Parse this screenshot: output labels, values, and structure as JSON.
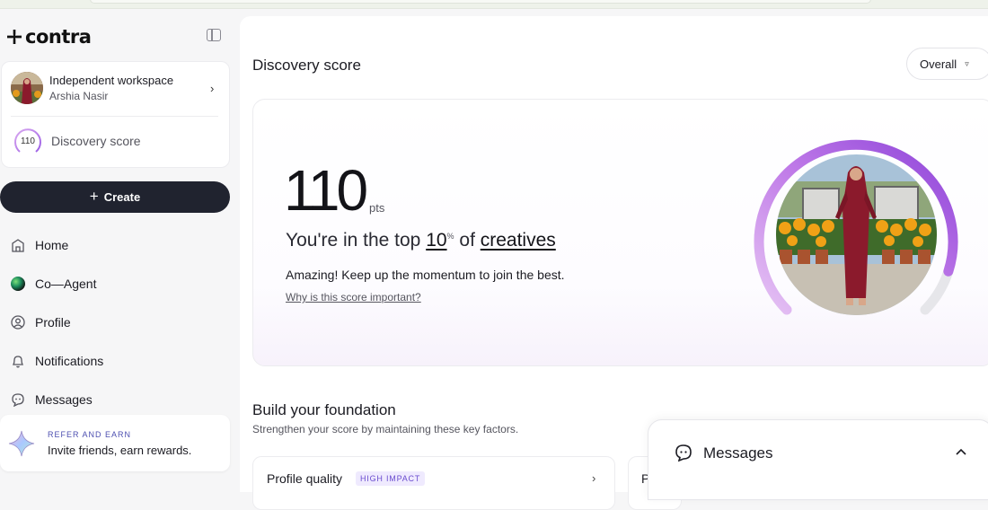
{
  "brand": {
    "name": "contra"
  },
  "workspace": {
    "title": "Independent workspace",
    "user": "Arshia Nasir",
    "score": "110",
    "score_label": "Discovery score"
  },
  "sidebar": {
    "create_label": "Create",
    "nav": [
      {
        "label": "Home",
        "icon": "home-icon"
      },
      {
        "label": "Co—Agent",
        "icon": "co-agent-icon"
      },
      {
        "label": "Profile",
        "icon": "profile-icon"
      },
      {
        "label": "Notifications",
        "icon": "bell-icon"
      },
      {
        "label": "Messages",
        "icon": "chat-icon"
      }
    ],
    "refer": {
      "kicker": "REFER AND EARN",
      "title": "Invite friends, earn rewards."
    }
  },
  "main": {
    "title": "Discovery score",
    "filter": {
      "selected": "Overall"
    },
    "score": {
      "value": "110",
      "unit": "pts",
      "top_prefix": "You're in the top ",
      "top_value": "10",
      "top_percent": "%",
      "top_mid": " of ",
      "top_group": "creatives",
      "message": "Amazing! Keep up the momentum to join the best.",
      "why_link": "Why is this score important?",
      "progress": 0.9
    },
    "foundation": {
      "title": "Build your foundation",
      "subtitle": "Strengthen your score by maintaining these key factors.",
      "cards": [
        {
          "title": "Profile quality",
          "badge": "HIGH IMPACT"
        },
        {
          "title": "P"
        }
      ]
    }
  },
  "messages_panel": {
    "title": "Messages"
  },
  "colors": {
    "accent": "#8b5cf6",
    "create_bg": "#20232f",
    "badge_bg": "#efeafe",
    "badge_text": "#6a4ccf"
  }
}
